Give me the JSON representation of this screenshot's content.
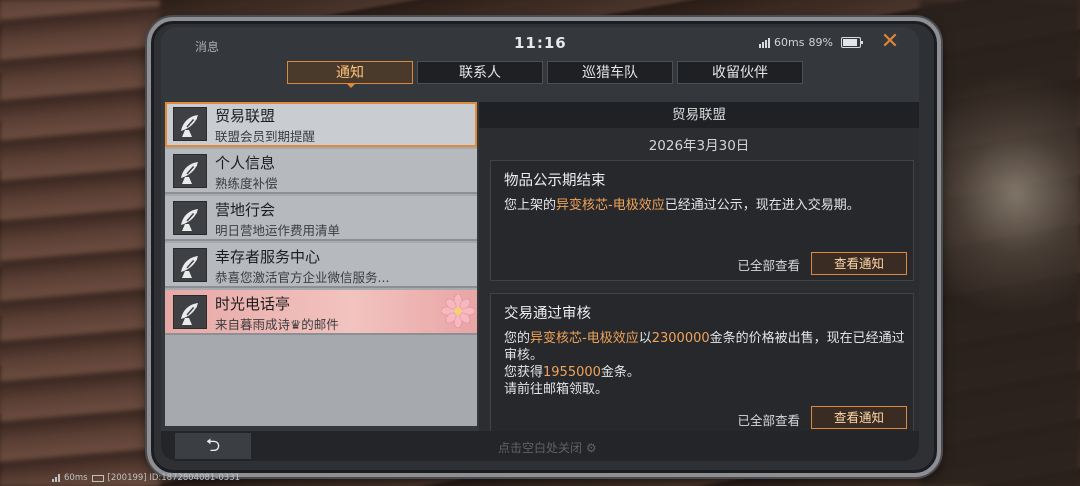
{
  "status": {
    "label": "消息",
    "time": "11:16",
    "network": "60ms",
    "battery": "89%"
  },
  "tabs": [
    "通知",
    "联系人",
    "巡猎车队",
    "收留伙伴"
  ],
  "list": [
    {
      "title": "贸易联盟",
      "sub": "联盟会员到期提醒",
      "state": "selected"
    },
    {
      "title": "个人信息",
      "sub": "熟练度补偿",
      "state": "normal"
    },
    {
      "title": "营地行会",
      "sub": "明日营地运作费用清单",
      "state": "normal"
    },
    {
      "title": "幸存者服务中心",
      "sub": "恭喜您激活官方企业微信服务...",
      "state": "normal"
    },
    {
      "title": "时光电话亭",
      "sub": "来自暮雨成诗♛的邮件",
      "state": "highlight"
    }
  ],
  "detail": {
    "header": "贸易联盟",
    "date": "2026年3月30日",
    "cards": [
      {
        "title": "物品公示期结束",
        "body_pre": "您上架的",
        "item": "异变核芯-电极效应",
        "body_post": "已经通过公示，现在进入交易期。",
        "read_all": "已全部查看",
        "view": "查看通知"
      },
      {
        "title": "交易通过审核",
        "line1_pre": "您的",
        "item": "异变核芯-电极效应",
        "line1_mid": "以",
        "price": "2300000",
        "line1_post": "金条的价格被出售，现在已经通过审核。",
        "line2_pre": "您获得",
        "gain": "1955000",
        "line2_post": "金条。",
        "line3": "请前往邮箱领取。",
        "read_all": "已全部查看",
        "view": "查看通知"
      }
    ]
  },
  "bottom": {
    "back": "⮌",
    "hint": "点击空白处关闭"
  },
  "footer": {
    "ping": "60ms",
    "id_text": "[200199] ID:1872804081-0331"
  },
  "colors": {
    "accent": "#d98a3e",
    "highlight_text": "#f0a35a"
  }
}
